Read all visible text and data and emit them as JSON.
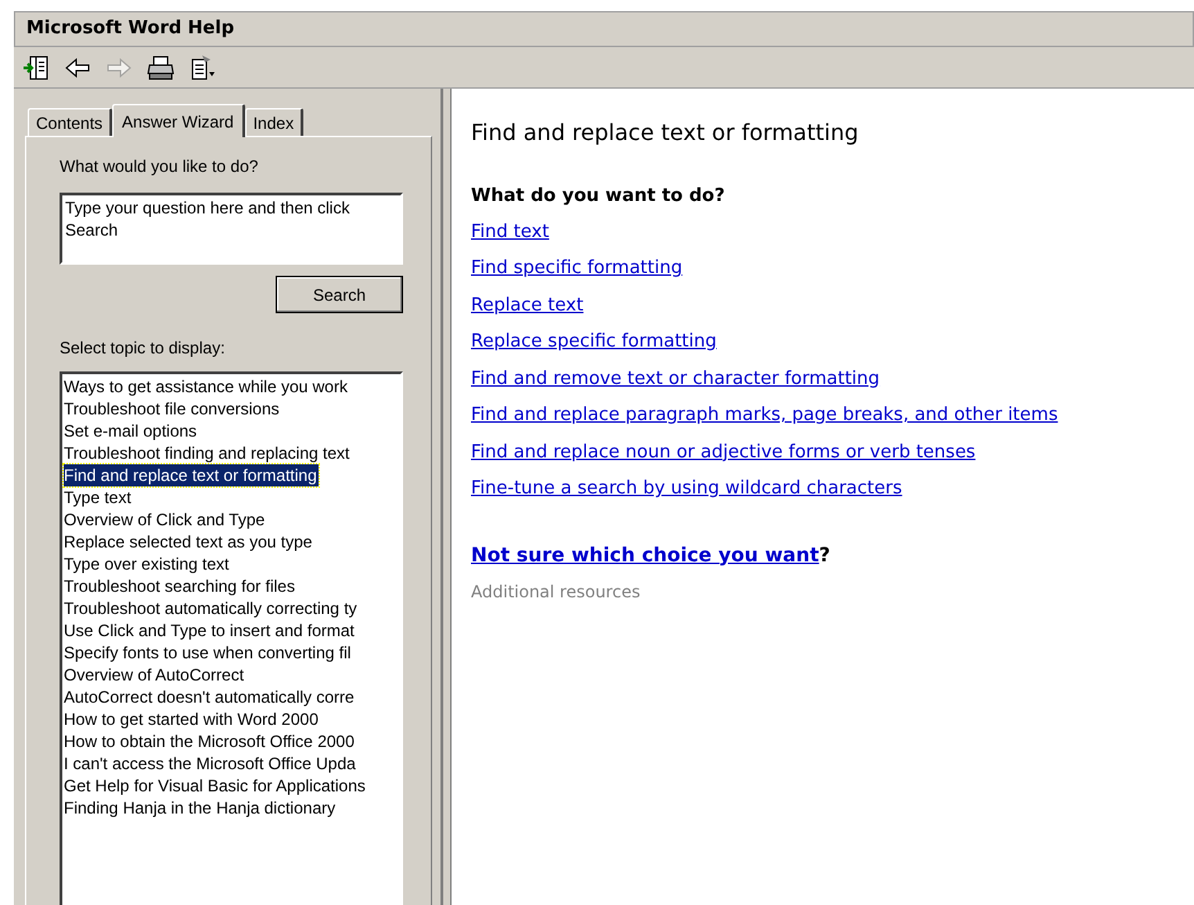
{
  "window": {
    "title": "Microsoft Word Help"
  },
  "toolbar": [
    {
      "kind": "show",
      "disabled": false
    },
    {
      "kind": "back",
      "disabled": false
    },
    {
      "kind": "forward",
      "disabled": true
    },
    {
      "kind": "print",
      "disabled": false
    },
    {
      "kind": "options",
      "disabled": false
    }
  ],
  "tabs": [
    {
      "label": "Contents",
      "selected": false
    },
    {
      "label": "Answer Wizard",
      "selected": true
    },
    {
      "label": "Index",
      "selected": false
    }
  ],
  "question": {
    "label": "What would you like to do?",
    "value": "Type your question here and then click Search"
  },
  "search_button": "Search",
  "topics": {
    "label": "Select topic to display:",
    "items": [
      {
        "text": "Ways to get assistance while you work",
        "selected": false
      },
      {
        "text": "Troubleshoot file conversions",
        "selected": false
      },
      {
        "text": "Set e-mail options",
        "selected": false
      },
      {
        "text": "Troubleshoot finding and replacing text",
        "selected": false
      },
      {
        "text": "Find and replace text or formatting",
        "selected": true
      },
      {
        "text": "Type text",
        "selected": false
      },
      {
        "text": "Overview of Click and Type",
        "selected": false
      },
      {
        "text": "Replace selected text as you type",
        "selected": false
      },
      {
        "text": "Type over existing text",
        "selected": false
      },
      {
        "text": "Troubleshoot searching for files",
        "selected": false
      },
      {
        "text": "Troubleshoot automatically correcting ty",
        "selected": false
      },
      {
        "text": "Use Click and Type to insert and format",
        "selected": false
      },
      {
        "text": "Specify fonts to use when converting fil",
        "selected": false
      },
      {
        "text": "Overview of AutoCorrect",
        "selected": false
      },
      {
        "text": "AutoCorrect doesn't automatically corre",
        "selected": false
      },
      {
        "text": "How to get started with Word 2000",
        "selected": false
      },
      {
        "text": "How to obtain the Microsoft Office 2000",
        "selected": false
      },
      {
        "text": "I can't access the Microsoft Office Upda",
        "selected": false
      },
      {
        "text": "Get Help for Visual Basic for Applications",
        "selected": false
      },
      {
        "text": "Finding Hanja in the Hanja dictionary",
        "selected": false
      }
    ]
  },
  "article": {
    "title": "Find and replace text or formatting",
    "subheading": "What do you want to do?",
    "links": [
      "Find text",
      "Find specific formatting",
      "Replace text",
      "Replace specific formatting",
      "Find and remove text or character formatting",
      "Find and replace paragraph marks, page breaks, and other items",
      "Find and replace noun or adjective forms or verb tenses",
      "Fine-tune a search by using wildcard characters"
    ],
    "more_link": "Not sure which choice you want",
    "more_suffix": "?",
    "additional": "Additional resources"
  }
}
